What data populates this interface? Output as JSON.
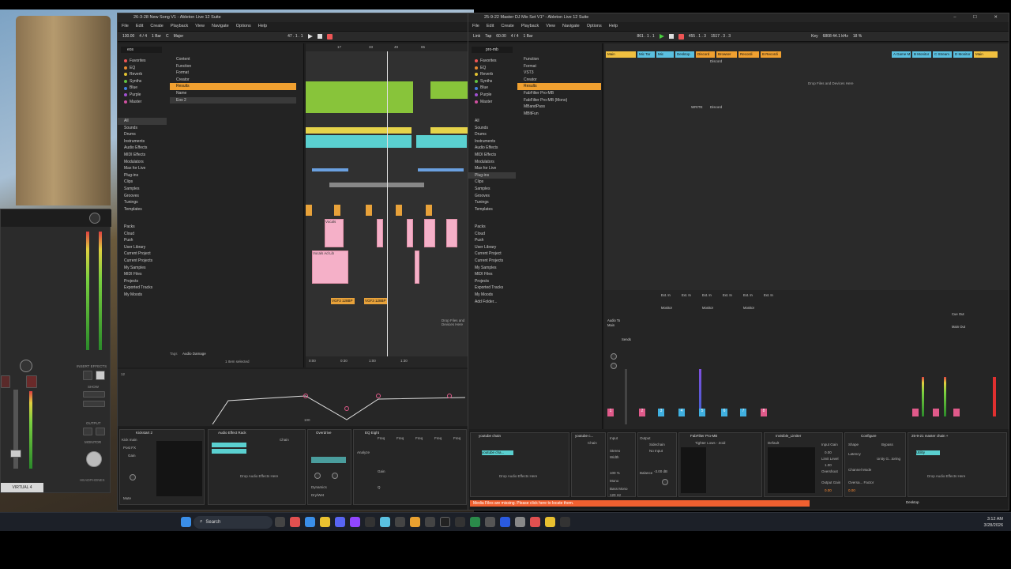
{
  "left_window": {
    "title": "26-3-28 New Song V1 - Ableton Live 12 Suite",
    "menu": [
      "File",
      "Edit",
      "Create",
      "Playback",
      "View",
      "Navigate",
      "Options",
      "Help"
    ],
    "tempo": "130.00",
    "meter": "4 / 4",
    "bar": "1 Bar",
    "key": "C",
    "scale": "Major",
    "position": "47 . 1 . 1",
    "search_value": "eos",
    "browser_filters": [
      "Content",
      "Function",
      "Format",
      "Creator",
      "Name"
    ],
    "results_label": "Results",
    "result_item": "Eos 2",
    "collections": [
      "Favorites",
      "EQ",
      "Reverb",
      "Synths",
      "Blue",
      "Purple",
      "Master"
    ],
    "library": [
      "All",
      "Sounds",
      "Drums",
      "Instruments",
      "Audio Effects",
      "MIDI Effects",
      "Modulators",
      "Max for Live",
      "Plug-ins",
      "Clips",
      "Samples",
      "Grooves",
      "Tunings",
      "Templates"
    ],
    "places": [
      "Packs",
      "Cloud",
      "Push",
      "User Library",
      "Current Project",
      "Current Projects",
      "My Samples",
      "MIDI Files",
      "Projects",
      "Exported Tracks",
      "My Moods"
    ],
    "tags_label": "Tags",
    "tags_value": "Audio Damage",
    "status": "1 Item selected",
    "drop_text": "Drop Files and Devices Here",
    "timeline_marks": [
      "17",
      "33",
      "49",
      "65"
    ],
    "bottom_times": [
      "0:00",
      "0:30",
      "1:00",
      "1:30"
    ],
    "clip_labels": [
      "VGF3 128BP",
      "VGF3 128BP"
    ],
    "track_labels": [
      "Vocals",
      "Vocals Ad Lib"
    ],
    "devices": {
      "kickstart": "Kickstart 2",
      "kick_main": "Kick main",
      "post_fx": "Post FX",
      "gain_label": "Gain",
      "mute_label": "Mute",
      "audio_effect_rack": "Audio Effect Rack",
      "drop_effects": "Drop Audio Effects Here",
      "overdrive": "Overdrive",
      "eq_eight": "EQ Eight",
      "chain_label": "Chain",
      "dry_wet": "Dry/Wet",
      "dynamics": "Dynamics",
      "freq_label": "Freq",
      "gain_short": "Gain",
      "q_label": "Q",
      "sidechain": "Sidechain",
      "analyze": "Analyze",
      "auto_label": "Auto",
      "envelope_values": [
        "12",
        "100"
      ]
    }
  },
  "right_window": {
    "title": "25-9-22 Master DJ Mix Set V1* - Ableton Live 12 Suite",
    "menu": [
      "File",
      "Edit",
      "Create",
      "Playback",
      "View",
      "Navigate",
      "Options",
      "Help"
    ],
    "link_label": "Link",
    "tap_label": "Tap",
    "tempo": "60.00",
    "meter": "4 / 4",
    "bar": "1 Bar",
    "position": "861 . 1 . 1",
    "loop_start": "455 . 1 . 3",
    "loop_len": "1517 . 3 . 3",
    "key_label": "Key",
    "sample_rate": "6808 44.1 kHz",
    "cpu": "18 %",
    "search_value": "pro-mb",
    "filters": [
      "Function",
      "Format",
      "Creator"
    ],
    "format_value": "VST3",
    "results": [
      "FabFilter Pro-MB",
      "FabFilter Pro-MB (Mono)",
      "MBandPass",
      "MBltFun"
    ],
    "results_label": "Results",
    "collections": [
      "Favorites",
      "EQ",
      "Reverb",
      "Synths",
      "Blue",
      "Purple",
      "Master"
    ],
    "library": [
      "All",
      "Sounds",
      "Drums",
      "Instruments",
      "Audio Effects",
      "MIDI Effects",
      "Modulators",
      "Max for Live",
      "Plug-ins",
      "Clips",
      "Samples",
      "Grooves",
      "Tunings",
      "Templates"
    ],
    "places": [
      "Packs",
      "Cloud",
      "Push",
      "User Library",
      "Current Project",
      "Current Projects",
      "My Samples",
      "MIDI Files",
      "Projects",
      "Exported Tracks",
      "My Moods",
      "Add Folder..."
    ],
    "track_names": [
      "Main",
      "Mic Tar",
      "Mic",
      "Desktop",
      "Discord",
      "Browser",
      "Recordi",
      "B Recordi"
    ],
    "right_tracks": [
      "A Game M",
      "B Monitor",
      "C Stream",
      "D Monitor",
      "Main"
    ],
    "drop_text": "Drop Files and Devices Here",
    "discord_label": "Discord",
    "write_label": "WRITE",
    "mixer_io": [
      "Ext. In",
      "Ext. In",
      "Ext. In",
      "Ext. In",
      "Ext. In",
      "Ext. In"
    ],
    "monitor": [
      "Monitor",
      "In",
      "Auto",
      "Off"
    ],
    "audio_to": "Audio To",
    "main_out": "Main",
    "sends": "Sends",
    "track_numbers": [
      "1",
      "2",
      "3",
      "4",
      "5",
      "6",
      "7",
      "8"
    ],
    "cue_out": "Cue Out",
    "main_out_label": "Main Out",
    "devices": {
      "chain1": "youtube chain",
      "chain2": "youtube c...",
      "chain_label": "Chain",
      "youtube_item": "youtube cha...",
      "drop_effects": "Drop Audio Effects Here",
      "input": "Input",
      "output": "Output",
      "stereo": "Stereo",
      "width": "Width",
      "mono": "Mono",
      "balance": "Balance",
      "bass_mono": "Bass Mono",
      "gain": "Gain",
      "sidechain": "Sidechain",
      "no_input": "No Input",
      "fabfilter": "FabFilter Pro-MB",
      "preset": "Tighter Lows - Zoid",
      "default": "Default",
      "invisible_limiter": "Invisible_Limiter",
      "configure": "Configure",
      "input_gain": "Input Gain",
      "limit_level": "Limit Level",
      "overshoot": "Overshoot",
      "output_gain": "Output Gain",
      "shape": "Shape",
      "latency": "Latency",
      "channel_mode": "Channel Mode",
      "oversample": "Oversa... Factor",
      "bypass": "Bypass",
      "unity_gain": "Unity G...toring",
      "master_chain": "25-9-21 master chain +",
      "utility": "Utility",
      "freq_hz": "120 Hz",
      "width_pct": "100 %",
      "balance_val": "-3.00 dB",
      "gain_values": [
        "0.00",
        "1.00",
        "0.00",
        "0.00"
      ]
    },
    "warning": "Media Files are missing. Please click here to locate them.",
    "desktop_label": "Desktop"
  },
  "uad": {
    "label": "VIRTUAL 4",
    "insert_effects": "INSERT EFFECTS",
    "show": "SHOW",
    "output": "OUTPUT",
    "monitor": "MONITOR",
    "headphones": "HEADPHONES"
  },
  "taskbar": {
    "search": "Search",
    "time": "3:12 AM",
    "date": "3/28/2026"
  },
  "colors": {
    "accent_orange": "#f0a030",
    "clip_green": "#88c43a",
    "clip_pink": "#f5b0c8",
    "warning": "#f06030"
  }
}
